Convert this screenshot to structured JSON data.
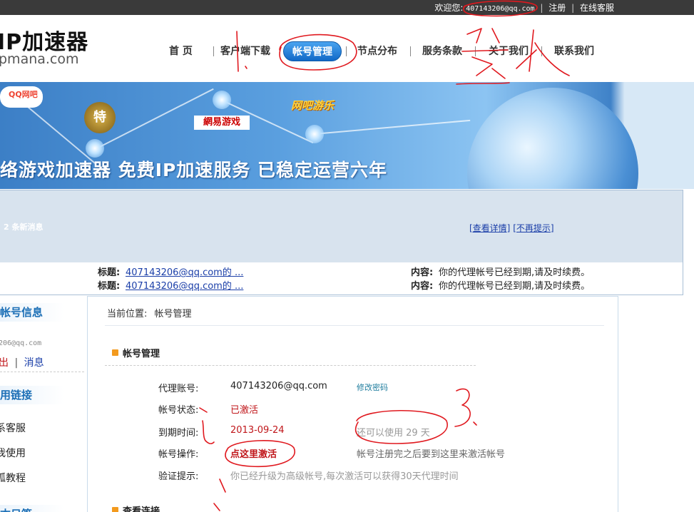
{
  "topbar": {
    "welcome_label": "欢迎您:",
    "user_email": "407143206@qq.com",
    "register_link": "注册",
    "support_link": "在线客服"
  },
  "header": {
    "logo_title": "IP加速器",
    "logo_domain": "pmana.com"
  },
  "nav": {
    "items": [
      {
        "label": "首 页"
      },
      {
        "label": "客户端下载"
      },
      {
        "label": "帐号管理",
        "active": true
      },
      {
        "label": "节点分布"
      },
      {
        "label": "服务条款"
      },
      {
        "label": "关于我们"
      },
      {
        "label": "联系我们"
      }
    ]
  },
  "banner": {
    "qq_badge": "QQ网吧",
    "seal_char": "特",
    "game_logo_163": "網易游戏",
    "game_logo_2": "网吧游乐",
    "slogan": "络游戏加速器  免费IP加速服务  已稳定运营六年"
  },
  "messages": {
    "new_count_text": "2 条新消息",
    "view_details": "[查看详情]",
    "no_remind": "[不再提示]",
    "title_label": "标题:",
    "content_label": "内容:",
    "rows": [
      {
        "title": "407143206@qq.com的 ...",
        "content": "你的代理帐号已经到期,请及时续费。"
      },
      {
        "title": "407143206@qq.com的 ...",
        "content": "你的代理帐号已经到期,请及时续费。"
      }
    ]
  },
  "sidebar": {
    "account_info_title": "帐号信息",
    "account_email": "206@qq.com",
    "logout_link": "出",
    "message_link": "消息",
    "links_title": "用链接",
    "links": [
      "系客服",
      "我使用",
      "狐教程"
    ],
    "bottom_title": "本日签"
  },
  "main": {
    "breadcrumb_label": "当前位置:",
    "breadcrumb_value": "帐号管理",
    "section_title": "帐号管理",
    "fields": {
      "account_label": "代理账号:",
      "account_value": "407143206@qq.com",
      "change_password": "修改密码",
      "status_label": "帐号状态:",
      "status_value": "已激活",
      "expire_label": "到期时间:",
      "expire_value": "2013-09-24",
      "remaining_text": "还可以使用 29 天",
      "operation_label": "帐号操作:",
      "operation_value": "点这里激活",
      "operation_hint": "帐号注册完之后要到这里来激活帐号",
      "verify_label": "验证提示:",
      "verify_value": "你已经升级为高级帐号,每次激活可以获得30天代理时间"
    },
    "next_section_title": "查看连接"
  },
  "colors": {
    "nav_active": "#1f7ad6",
    "link_blue": "#1a3ea8",
    "alert_red": "#c0161a",
    "scribble_red": "#e0191f",
    "sidebar_title_blue": "#1c6fb6"
  }
}
